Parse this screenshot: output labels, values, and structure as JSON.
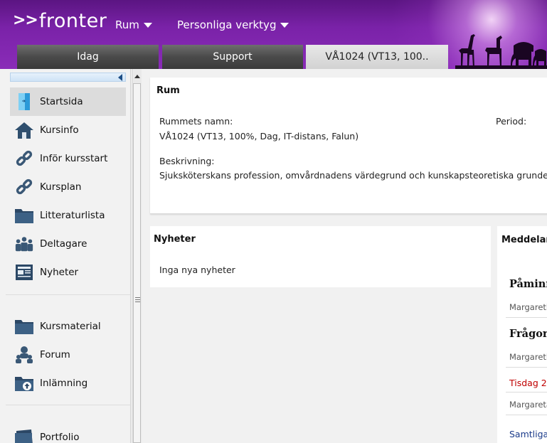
{
  "header": {
    "logo_text": "fronter",
    "logo_arrows": ">>",
    "menu_rum": "Rum",
    "menu_personliga": "Personliga verktyg",
    "tabs": [
      {
        "label": "Idag"
      },
      {
        "label": "Support"
      },
      {
        "label": "VÅ1024 (VT13, 100.."
      }
    ]
  },
  "sidebar": {
    "items": [
      {
        "label": "Startsida",
        "icon": "door-icon",
        "active": true
      },
      {
        "label": "Kursinfo",
        "icon": "house-icon"
      },
      {
        "label": "Inför kursstart",
        "icon": "link-icon"
      },
      {
        "label": "Kursplan",
        "icon": "link-icon"
      },
      {
        "label": "Litteraturlista",
        "icon": "folder-icon"
      },
      {
        "label": "Deltagare",
        "icon": "people-icon"
      },
      {
        "label": "Nyheter",
        "icon": "newspaper-icon"
      },
      {
        "label": "Kursmaterial",
        "icon": "folder-icon"
      },
      {
        "label": "Forum",
        "icon": "forum-icon"
      },
      {
        "label": "Inlämning",
        "icon": "upload-folder-icon"
      },
      {
        "label": "Portfolio",
        "icon": "portfolio-icon"
      }
    ]
  },
  "room": {
    "title": "Rum",
    "name_label": "Rummets namn:",
    "name_value": "VÅ1024 (VT13, 100%, Dag, IT-distans, Falun)",
    "period_label": "Period:",
    "desc_label": "Beskrivning:",
    "desc_value": "Sjuksköterskans profession, omvårdnadens värdegrund och kunskapsteoretiska grunder"
  },
  "news": {
    "title": "Nyheter",
    "empty_text": "Inga nya nyheter"
  },
  "messages": {
    "title": "Meddelan",
    "items": [
      {
        "heading": "Påminn",
        "author": "Margareth"
      },
      {
        "heading": "Frågor",
        "author": "Margareth"
      }
    ],
    "date": "Tisdag 2",
    "date_author": "Margareta",
    "link": "Samtliga"
  },
  "colors": {
    "header_purple": "#7a22a8",
    "active_item_bg": "#dcdcdc",
    "date_red": "#c00000",
    "link_blue": "#1a3a8a"
  }
}
